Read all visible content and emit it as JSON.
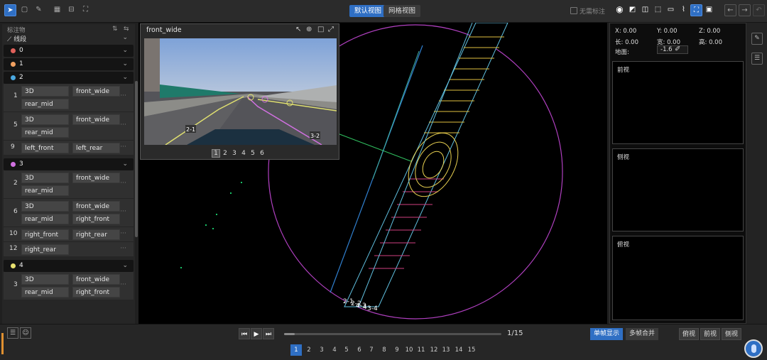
{
  "toolbar": {
    "left_icons": [
      "cursor-icon",
      "polygon-icon",
      "brush-icon",
      "grid-icon",
      "split-icon",
      "expand-icon"
    ],
    "view_tabs": [
      "默认视图",
      "网格视图"
    ],
    "no_label_text": "无需标注",
    "right_icons": [
      "target-icon",
      "fill-icon",
      "panel-icon",
      "tag-icon",
      "monitor-icon",
      "connect-icon",
      "fit-icon",
      "truck-icon",
      "import-icon",
      "export-icon",
      "undo-icon"
    ]
  },
  "left_panel": {
    "header": "标注物",
    "category": "线段",
    "groups": [
      {
        "id": "0",
        "color": "#e0605a",
        "items": []
      },
      {
        "id": "1",
        "color": "#f0a060",
        "items": []
      },
      {
        "id": "2",
        "color": "#4aa8e0",
        "items": [
          {
            "num": "1",
            "tags": [
              "3D",
              "front_wide",
              "rear_mid"
            ]
          },
          {
            "num": "5",
            "tags": [
              "3D",
              "front_wide",
              "rear_mid"
            ]
          },
          {
            "num": "9",
            "tags": [
              "left_front",
              "left_rear"
            ]
          }
        ]
      },
      {
        "id": "3",
        "color": "#d070e0",
        "items": [
          {
            "num": "2",
            "tags": [
              "3D",
              "front_wide",
              "rear_mid"
            ]
          },
          {
            "num": "6",
            "tags": [
              "3D",
              "front_wide",
              "rear_mid",
              "right_front"
            ]
          },
          {
            "num": "10",
            "tags": [
              "right_front",
              "right_rear"
            ]
          },
          {
            "num": "12",
            "tags": [
              "right_rear"
            ]
          }
        ]
      },
      {
        "id": "4",
        "color": "#e8e070",
        "items": [
          {
            "num": "3",
            "tags": [
              "3D",
              "front_wide",
              "rear_mid",
              "right_front"
            ]
          }
        ]
      }
    ],
    "more": "···"
  },
  "camera": {
    "title": "front_wide",
    "pages": [
      "1",
      "2",
      "3",
      "4",
      "5",
      "6"
    ],
    "labels": [
      "2-1",
      "3-2"
    ]
  },
  "viewport": {
    "labels": [
      "2-1",
      "2-2",
      "4-3",
      "4",
      "3-4"
    ]
  },
  "right_panel": {
    "coords": {
      "x": "X: 0.00",
      "y": "Y: 0.00",
      "z": "Z: 0.00",
      "l": "长: 0.00",
      "w": "宽: 0.00",
      "h": "高: 0.00"
    },
    "ground_label": "地面:",
    "ground_value": "-1.6",
    "views": [
      "前视",
      "侧视",
      "俯视"
    ]
  },
  "bottom": {
    "frame_counter": "1/15",
    "progress": 0.05,
    "modes": [
      "单帧显示",
      "多帧合并"
    ],
    "views": [
      "俯视",
      "前视",
      "侧视"
    ],
    "frames": [
      "1",
      "2",
      "3",
      "4",
      "5",
      "6",
      "7",
      "8",
      "9",
      "10",
      "11",
      "12",
      "13",
      "14",
      "15"
    ]
  }
}
